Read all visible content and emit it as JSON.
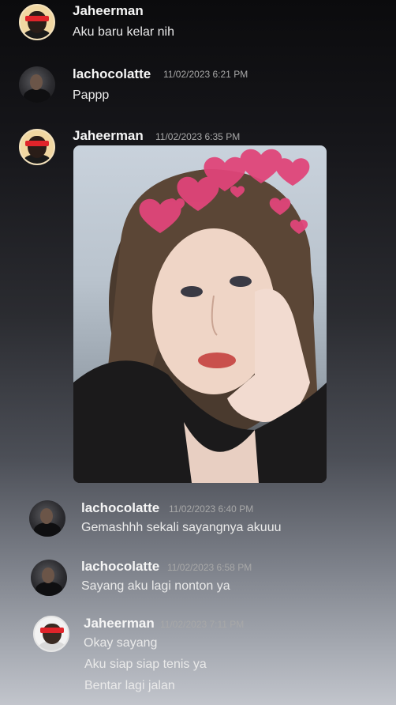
{
  "messages": [
    {
      "username": "Jaheerman",
      "timestamp": "",
      "lines": [
        "Aku baru kelar nih"
      ]
    },
    {
      "username": "lachocolatte",
      "timestamp": "11/02/2023 6:21 PM",
      "lines": [
        "Pappp"
      ]
    },
    {
      "username": "Jaheerman",
      "timestamp": "11/02/2023 6:35 PM",
      "lines": []
    },
    {
      "username": "lachocolatte",
      "timestamp": "11/02/2023 6:40 PM",
      "lines": [
        "Gemashhh sekali sayangnya akuuu"
      ]
    },
    {
      "username": "lachocolatte",
      "timestamp": "11/02/2023 6:58 PM",
      "lines": [
        "Sayang aku lagi nonton ya"
      ]
    },
    {
      "username": "Jaheerman",
      "timestamp": "11/02/2023 7:11 PM",
      "lines": [
        "Okay sayang",
        "Aku siap siap tenis ya",
        "Bentar lagi jalan"
      ]
    }
  ],
  "colors": {
    "username": "#f5f5f5",
    "timestamp": "#a8a8a8",
    "text": "#eaeaea",
    "heart": "#e0457a"
  },
  "icons": {
    "avatar_jaheerman": "avatar-red-eyeband",
    "avatar_lachocolatte": "avatar-silhouette"
  }
}
